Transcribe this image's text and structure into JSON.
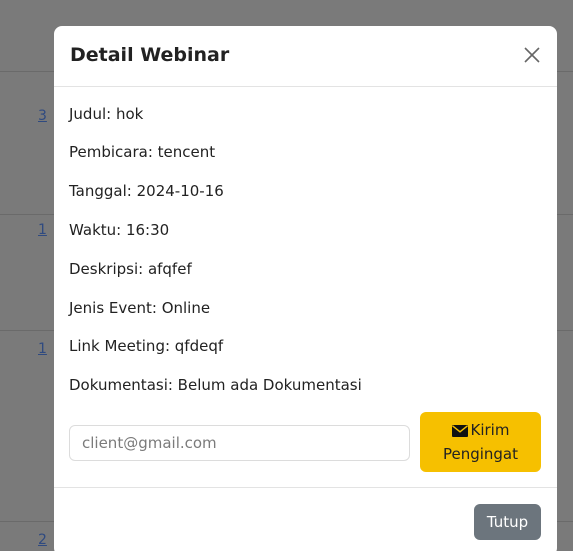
{
  "background": {
    "row_links": [
      "3",
      "1",
      "1",
      "2"
    ]
  },
  "modal": {
    "title": "Detail Webinar",
    "details": {
      "judul": "Judul: hok",
      "pembicara": "Pembicara: tencent",
      "tanggal": "Tanggal: 2024-10-16",
      "waktu": "Waktu: 16:30",
      "deskripsi": "Deskripsi: afqfef",
      "jenis_event": "Jenis Event: Online",
      "link_meeting": "Link Meeting: qfdeqf",
      "dokumentasi": "Dokumentasi: Belum ada Dokumentasi"
    },
    "email_input": {
      "placeholder": "client@gmail.com",
      "value": ""
    },
    "send_button": {
      "line1": "Kirim",
      "line2": "Pengingat",
      "icon": "envelope-icon"
    },
    "close_icon": "close-icon",
    "footer_close_label": "Tutup"
  },
  "colors": {
    "overlay": "#7a7a7a",
    "send_button": "#f6c000",
    "close_button": "#6c757d"
  }
}
